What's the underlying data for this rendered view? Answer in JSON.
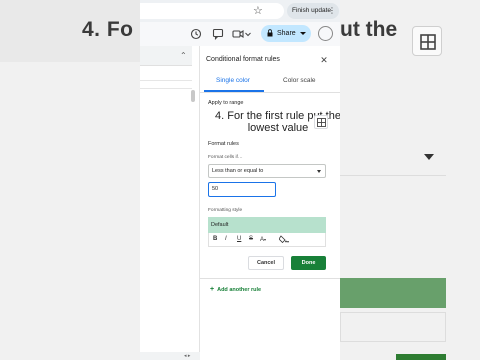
{
  "background": {
    "left_title": "4. Fo",
    "right_title": "ut the"
  },
  "browser": {
    "star_icon": "star-icon",
    "finish_update": "Finish update"
  },
  "toolbar": {
    "share_label": "Share"
  },
  "panel": {
    "title": "Conditional format rules",
    "tabs": [
      "Single color",
      "Color scale"
    ],
    "active_tab": "Single color",
    "apply_to_range_label": "Apply to range",
    "overlay_caption": "4. For the first rule put the lowest value",
    "format_rules_label": "Format rules",
    "format_cells_if_label": "Format cells if…",
    "condition_value": "Less than or equal to",
    "value_input": "50",
    "formatting_style_label": "Formatting style",
    "style_preview": "Default",
    "style_tools": [
      "B",
      "I",
      "U",
      "S",
      "A",
      "fill"
    ],
    "cancel_label": "Cancel",
    "done_label": "Done",
    "add_rule_label": "Add another rule"
  },
  "colors": {
    "accent_blue": "#1a73e8",
    "done_green": "#188038",
    "style_fill": "#b7e1cd",
    "share_bg": "#c2e7ff"
  }
}
